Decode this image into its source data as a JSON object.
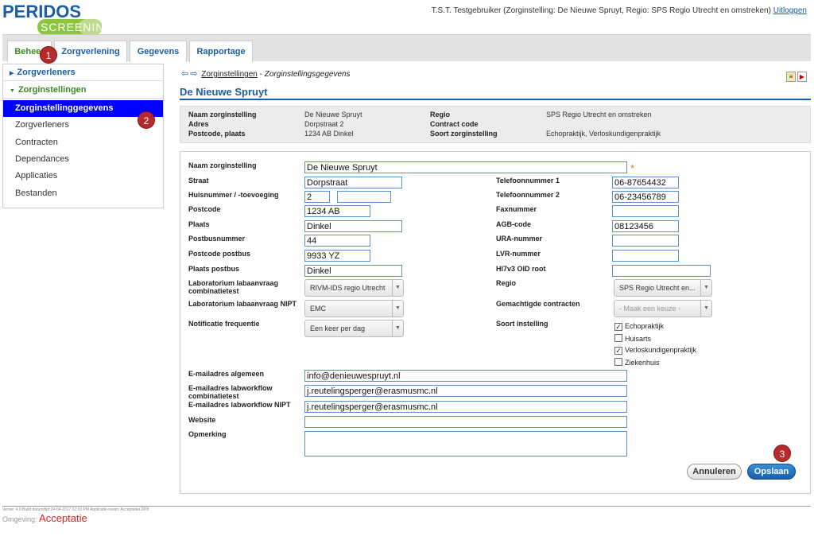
{
  "header": {
    "logo_top": "PERIDOS",
    "logo_bottom": "SCREENING",
    "user_line": "T.S.T. Testgebruiker (Zorginstelling: De Nieuwe Spruyt, Regio: SPS Regio Utrecht en omstreken)",
    "logout": "Uitloggen"
  },
  "tabs": [
    {
      "label": "Beheer"
    },
    {
      "label": "Zorgverlening"
    },
    {
      "label": "Gegevens"
    },
    {
      "label": "Rapportage"
    }
  ],
  "badges": [
    "1",
    "2",
    "3"
  ],
  "sidebar": {
    "group1": "Zorgverleners",
    "group2": "Zorginstellingen",
    "items": [
      "Zorginstellinggegevens",
      "Zorgverleners",
      "Contracten",
      "Dependances",
      "Applicaties",
      "Bestanden"
    ]
  },
  "breadcrumb": {
    "link": "Zorginstellingen",
    "separator": " - ",
    "current": "Zorginstellingsgegevens"
  },
  "page_title": "De Nieuwe Spruyt",
  "summary": {
    "naam_label": "Naam zorginstelling",
    "naam": "De Nieuwe Spruyt",
    "adres_label": "Adres",
    "adres": "Dorpstraat 2",
    "postcode_label": "Postcode, plaats",
    "postcode": "1234 AB  Dinkel",
    "regio_label": "Regio",
    "regio": "SPS Regio Utrecht en omstreken",
    "contract_label": "Contract code",
    "contract": "",
    "soort_label": "Soort zorginstelling",
    "soort": "Echopraktijk, Verloskundigenpraktijk"
  },
  "form": {
    "naam_label": "Naam zorginstelling",
    "naam": "De Nieuwe Spruyt",
    "straat_label": "Straat",
    "straat": "Dorpstraat",
    "huisnr_label": "Huisnummer / -toevoeging",
    "huisnr": "2",
    "toevoeging": "",
    "postcode_label": "Postcode",
    "postcode": "1234 AB",
    "plaats_label": "Plaats",
    "plaats": "Dinkel",
    "postbus_label": "Postbusnummer",
    "postbus": "44",
    "postcode_postbus_label": "Postcode postbus",
    "postcode_postbus": "9933 YZ",
    "plaats_postbus_label": "Plaats postbus",
    "plaats_postbus": "Dinkel",
    "lab_combi_label": "Laboratorium labaanvraag combinatietest",
    "lab_combi": "RIVM-IDS regio Utrecht",
    "lab_nipt_label": "Laboratorium labaanvraag NIPT",
    "lab_nipt": "EMC",
    "notif_label": "Notificatie frequentie",
    "notif": "Een keer per dag",
    "tel1_label": "Telefoonnummer 1",
    "tel1": "06-87654432",
    "tel2_label": "Telefoonnummer 2",
    "tel2": "06-23456789",
    "fax_label": "Faxnummer",
    "fax": "",
    "agb_label": "AGB-code",
    "agb": "08123456",
    "ura_label": "URA-nummer",
    "ura": "",
    "lvr_label": "LVR-nummer",
    "lvr": "",
    "hl7_label": "Hl7v3 OID root",
    "hl7": "",
    "regio_label": "Regio",
    "regio": "SPS Regio Utrecht en...",
    "gemachtigde_label": "Gemachtigde contracten",
    "gemachtigde": "- Maak een keuze -",
    "soort_label": "Soort instelling",
    "soort_opties": [
      {
        "label": "Echopraktijk",
        "checked": "✓"
      },
      {
        "label": "Huisarts",
        "checked": ""
      },
      {
        "label": "Verloskundigenpraktijk",
        "checked": "✓"
      },
      {
        "label": "Ziekenhuis",
        "checked": ""
      }
    ],
    "email_alg_label": "E-mailadres algemeen",
    "email_alg": "info@denieuwespruyt.nl",
    "email_combi_label": "E-mailadres labworkflow combinatietest",
    "email_combi": "j.reutelingsperger@erasmusmc.nl",
    "email_nipt_label": "E-mailadres labworkflow NIPT",
    "email_nipt": "j.reutelingsperger@erasmusmc.nl",
    "website_label": "Website",
    "website": "",
    "opmerking_label": "Opmerking",
    "opmerking": "",
    "required_mark": "*"
  },
  "buttons": {
    "cancel": "Annuleren",
    "save": "Opslaan"
  },
  "footer": {
    "version": "Versie: 4.0 Build datum/tijd:24-04-2017 02:03 PM Applicatie-naam: AcceptatieLDP8",
    "env_label": "Omgeving:",
    "env_value": "Acceptatie"
  },
  "colors": {
    "brand": "#1a5ea8",
    "active_nav": "#0000ff",
    "badge": "#b52a2a",
    "accent_green": "#3a8a20"
  }
}
